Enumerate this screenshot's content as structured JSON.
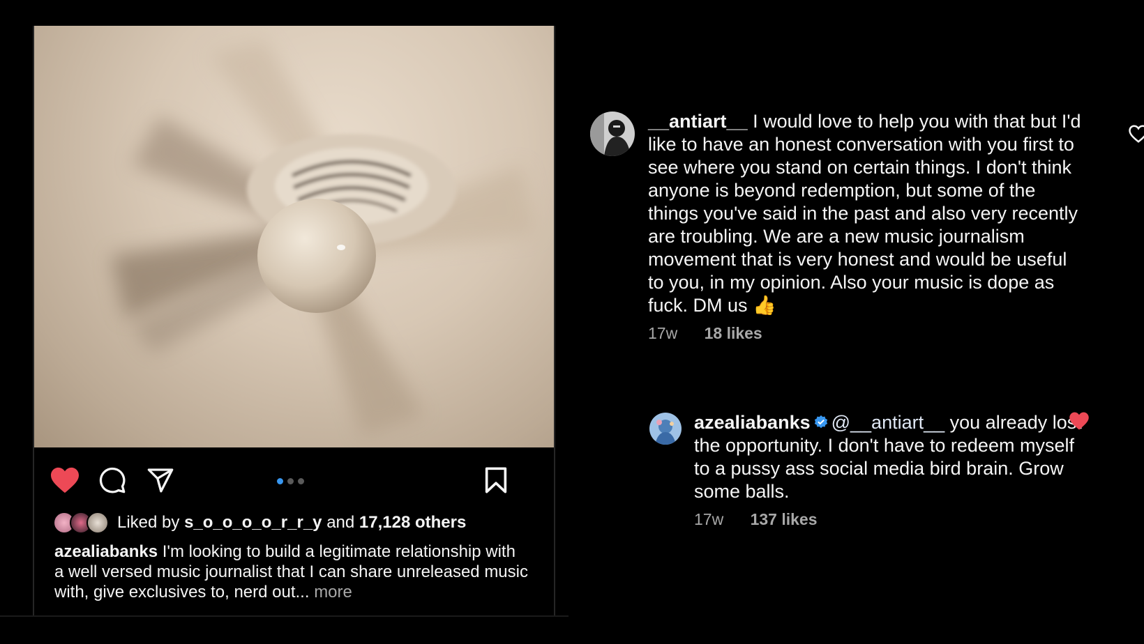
{
  "post": {
    "photo_alt": "ceiling-fan-photo",
    "carousel": {
      "count": 3,
      "active_index": 0
    },
    "liked_by": {
      "prefix": "Liked by",
      "user": "s_o_o_o_o_r_r_y",
      "and": "and",
      "others": "17,128 others"
    },
    "caption": {
      "username": "azealiabanks",
      "text": "I'm looking to build a legitimate relationship with a well versed music journalist that I can share unreleased music with, give exclusives to, nerd out...",
      "more": "more"
    },
    "like_state": "liked"
  },
  "comments": [
    {
      "username": "__antiart__",
      "text": "I would love to help you with that but I'd like to have an honest conversation with you first to see where you stand on certain things. I don't think anyone is beyond redemption, but some of the things you've said in the past and also very recently are troubling. We are a new music journalism movement that is very honest and would be useful to you, in my opinion. Also your music is dope as fuck. DM us 👍",
      "time": "17w",
      "likes": "18 likes",
      "liked": false
    },
    {
      "username": "azealiabanks",
      "verified": true,
      "mention": "@__antiart__",
      "text": "you already lost the opportunity. I don't have to redeem myself to a pussy ass social media bird brain. Grow some balls.",
      "time": "17w",
      "likes": "137 likes",
      "liked": true
    }
  ],
  "colors": {
    "background": "#000000",
    "like_red": "#ed4956",
    "active_dot": "#3897f0",
    "verified_blue": "#3897f0",
    "muted_text": "#a8a8a8"
  }
}
